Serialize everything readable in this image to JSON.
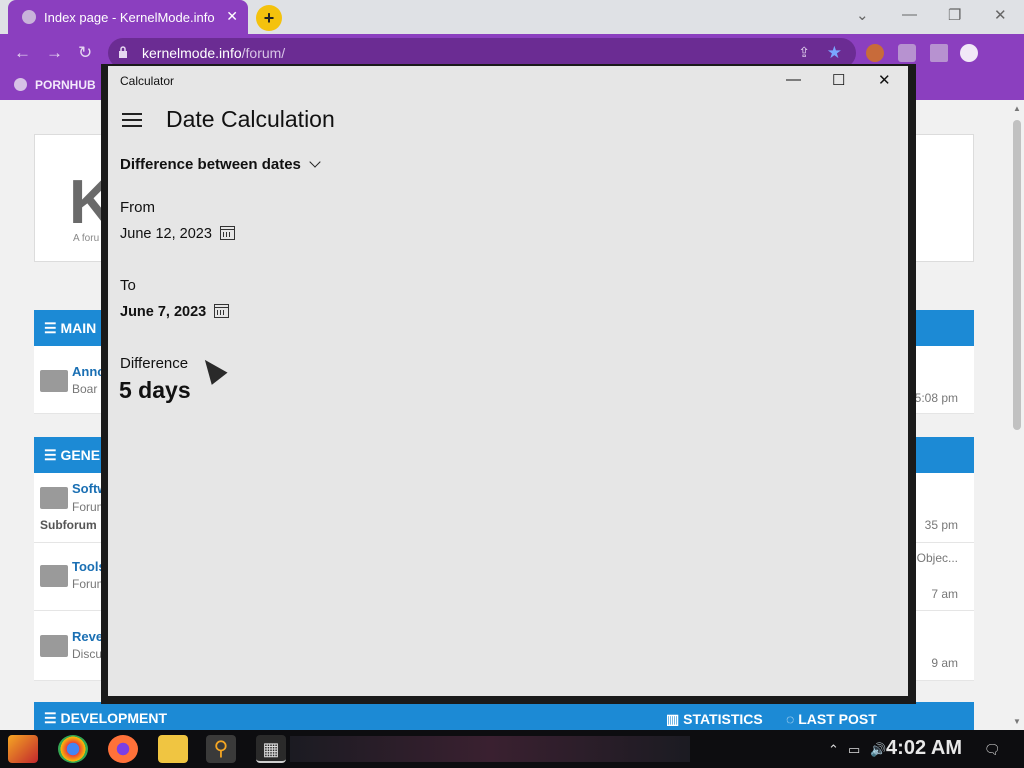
{
  "browser": {
    "tab_title": "Index page - KernelMode.info",
    "tab_close": "✕",
    "new_tab": "+",
    "url_host": "kernelmode.info",
    "url_path": "/forum/",
    "bookmark_label": "PORNHUB",
    "window_controls": {
      "minimize": "—",
      "restore": "❐",
      "close": "✕",
      "dropdown": "⌄"
    },
    "nav": {
      "back": "←",
      "forward": "→",
      "reload": "↻"
    },
    "icons": [
      "lock-icon",
      "share-icon",
      "star-icon",
      "extensions-icon",
      "sidepanel-icon",
      "profile-icon"
    ],
    "accent": "#8b3fbf"
  },
  "forum": {
    "logo_fragment": "K",
    "logo_sub": "A foru",
    "sections": [
      {
        "label": "MAIN"
      },
      {
        "label": "GENE"
      }
    ],
    "rows": [
      {
        "title": "Anno",
        "sub": "Boar",
        "right": "5:08 pm"
      },
      {
        "title": "Softw",
        "sub": "Forum",
        "extra": "Subforum",
        "right": "35 pm"
      },
      {
        "title": "Tools",
        "sub": "Forum",
        "right_top": "Objec...",
        "right": "7 am"
      },
      {
        "title": "Reve",
        "sub": "Discu",
        "right": "9 am"
      }
    ],
    "dev_label": "DEVELOPMENT",
    "stats_label": "STATISTICS",
    "lastpost_label": "LAST POST"
  },
  "calculator": {
    "window_title": "Calculator",
    "controls": {
      "minimize": "—",
      "maximize": "☐",
      "close": "✕"
    },
    "mode_title": "Date Calculation",
    "calc_mode": "Difference between dates",
    "from_label": "From",
    "from_date": "June 12, 2023",
    "to_label": "To",
    "to_date": "June 7, 2023",
    "difference_label": "Difference",
    "difference_value": "5 days"
  },
  "taskbar": {
    "clock": "4:02 AM",
    "tray_up": "⌃",
    "tray_volume": "🔊",
    "tray_notif": "🗨"
  }
}
